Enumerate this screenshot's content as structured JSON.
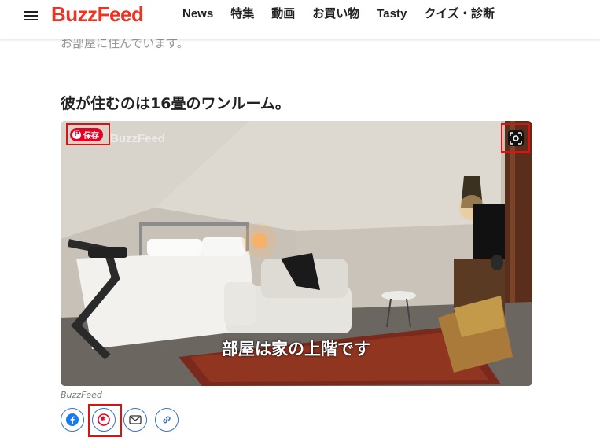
{
  "header": {
    "logo": "BuzzFeed",
    "nav": [
      "News",
      "特集",
      "動画",
      "お買い物",
      "Tasty",
      "クイズ・診断"
    ]
  },
  "article": {
    "prev_text": "お部屋に住んでいます。",
    "heading": "彼が住むのは16畳のワンルーム。",
    "watermark": "BuzzFeed",
    "save_label": "保存",
    "caption": "部屋は家の上階です",
    "credit": "BuzzFeed"
  },
  "share": {
    "buttons": [
      "facebook",
      "pinterest",
      "email",
      "copy-link"
    ]
  },
  "colors": {
    "brand": "#ee3322",
    "pinterest": "#e60023",
    "share_outline": "#3572c6",
    "highlight": "#e01010"
  }
}
